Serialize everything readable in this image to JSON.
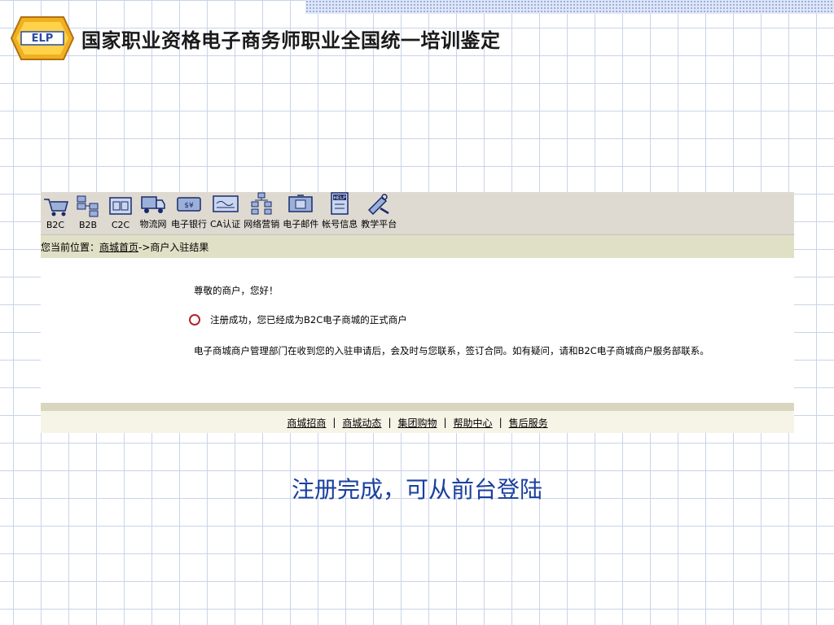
{
  "header": {
    "title": "国家职业资格电子商务师职业全国统一培训鉴定"
  },
  "toolbar": {
    "items": [
      {
        "label": "B2C",
        "icon": "shopping-cart-icon"
      },
      {
        "label": "B2B",
        "icon": "network-boxes-icon"
      },
      {
        "label": "C2C",
        "icon": "c2c-screen-icon"
      },
      {
        "label": "物流网",
        "icon": "truck-icon"
      },
      {
        "label": "电子银行",
        "icon": "money-icon"
      },
      {
        "label": "CA认证",
        "icon": "certificate-icon"
      },
      {
        "label": "网络营销",
        "icon": "hierarchy-icon"
      },
      {
        "label": "电子邮件",
        "icon": "mail-icon"
      },
      {
        "label": "帐号信息",
        "icon": "help-document-icon"
      },
      {
        "label": "教学平台",
        "icon": "tools-icon"
      }
    ]
  },
  "breadcrumb": {
    "prefix": "您当前位置：",
    "home": "商城首页",
    "current": " ->商户入驻结果"
  },
  "content": {
    "greeting": "尊敬的商户，您好！",
    "status": "注册成功，您已经成为B2C电子商城的正式商户",
    "notice": "电子商城商户管理部门在收到您的入驻申请后，会及时与您联系，签订合同。如有疑问，请和B2C电子商城商户服务部联系。"
  },
  "footer": {
    "links": [
      "商城招商",
      "商城动态",
      "集团购物",
      "帮助中心",
      "售后服务"
    ],
    "separator": "|"
  },
  "caption": "注册完成，可从前台登陆",
  "colors": {
    "caption": "#1a3fa0",
    "status_circle": "#b2262a",
    "toolbar_bg": "#dedad2"
  }
}
